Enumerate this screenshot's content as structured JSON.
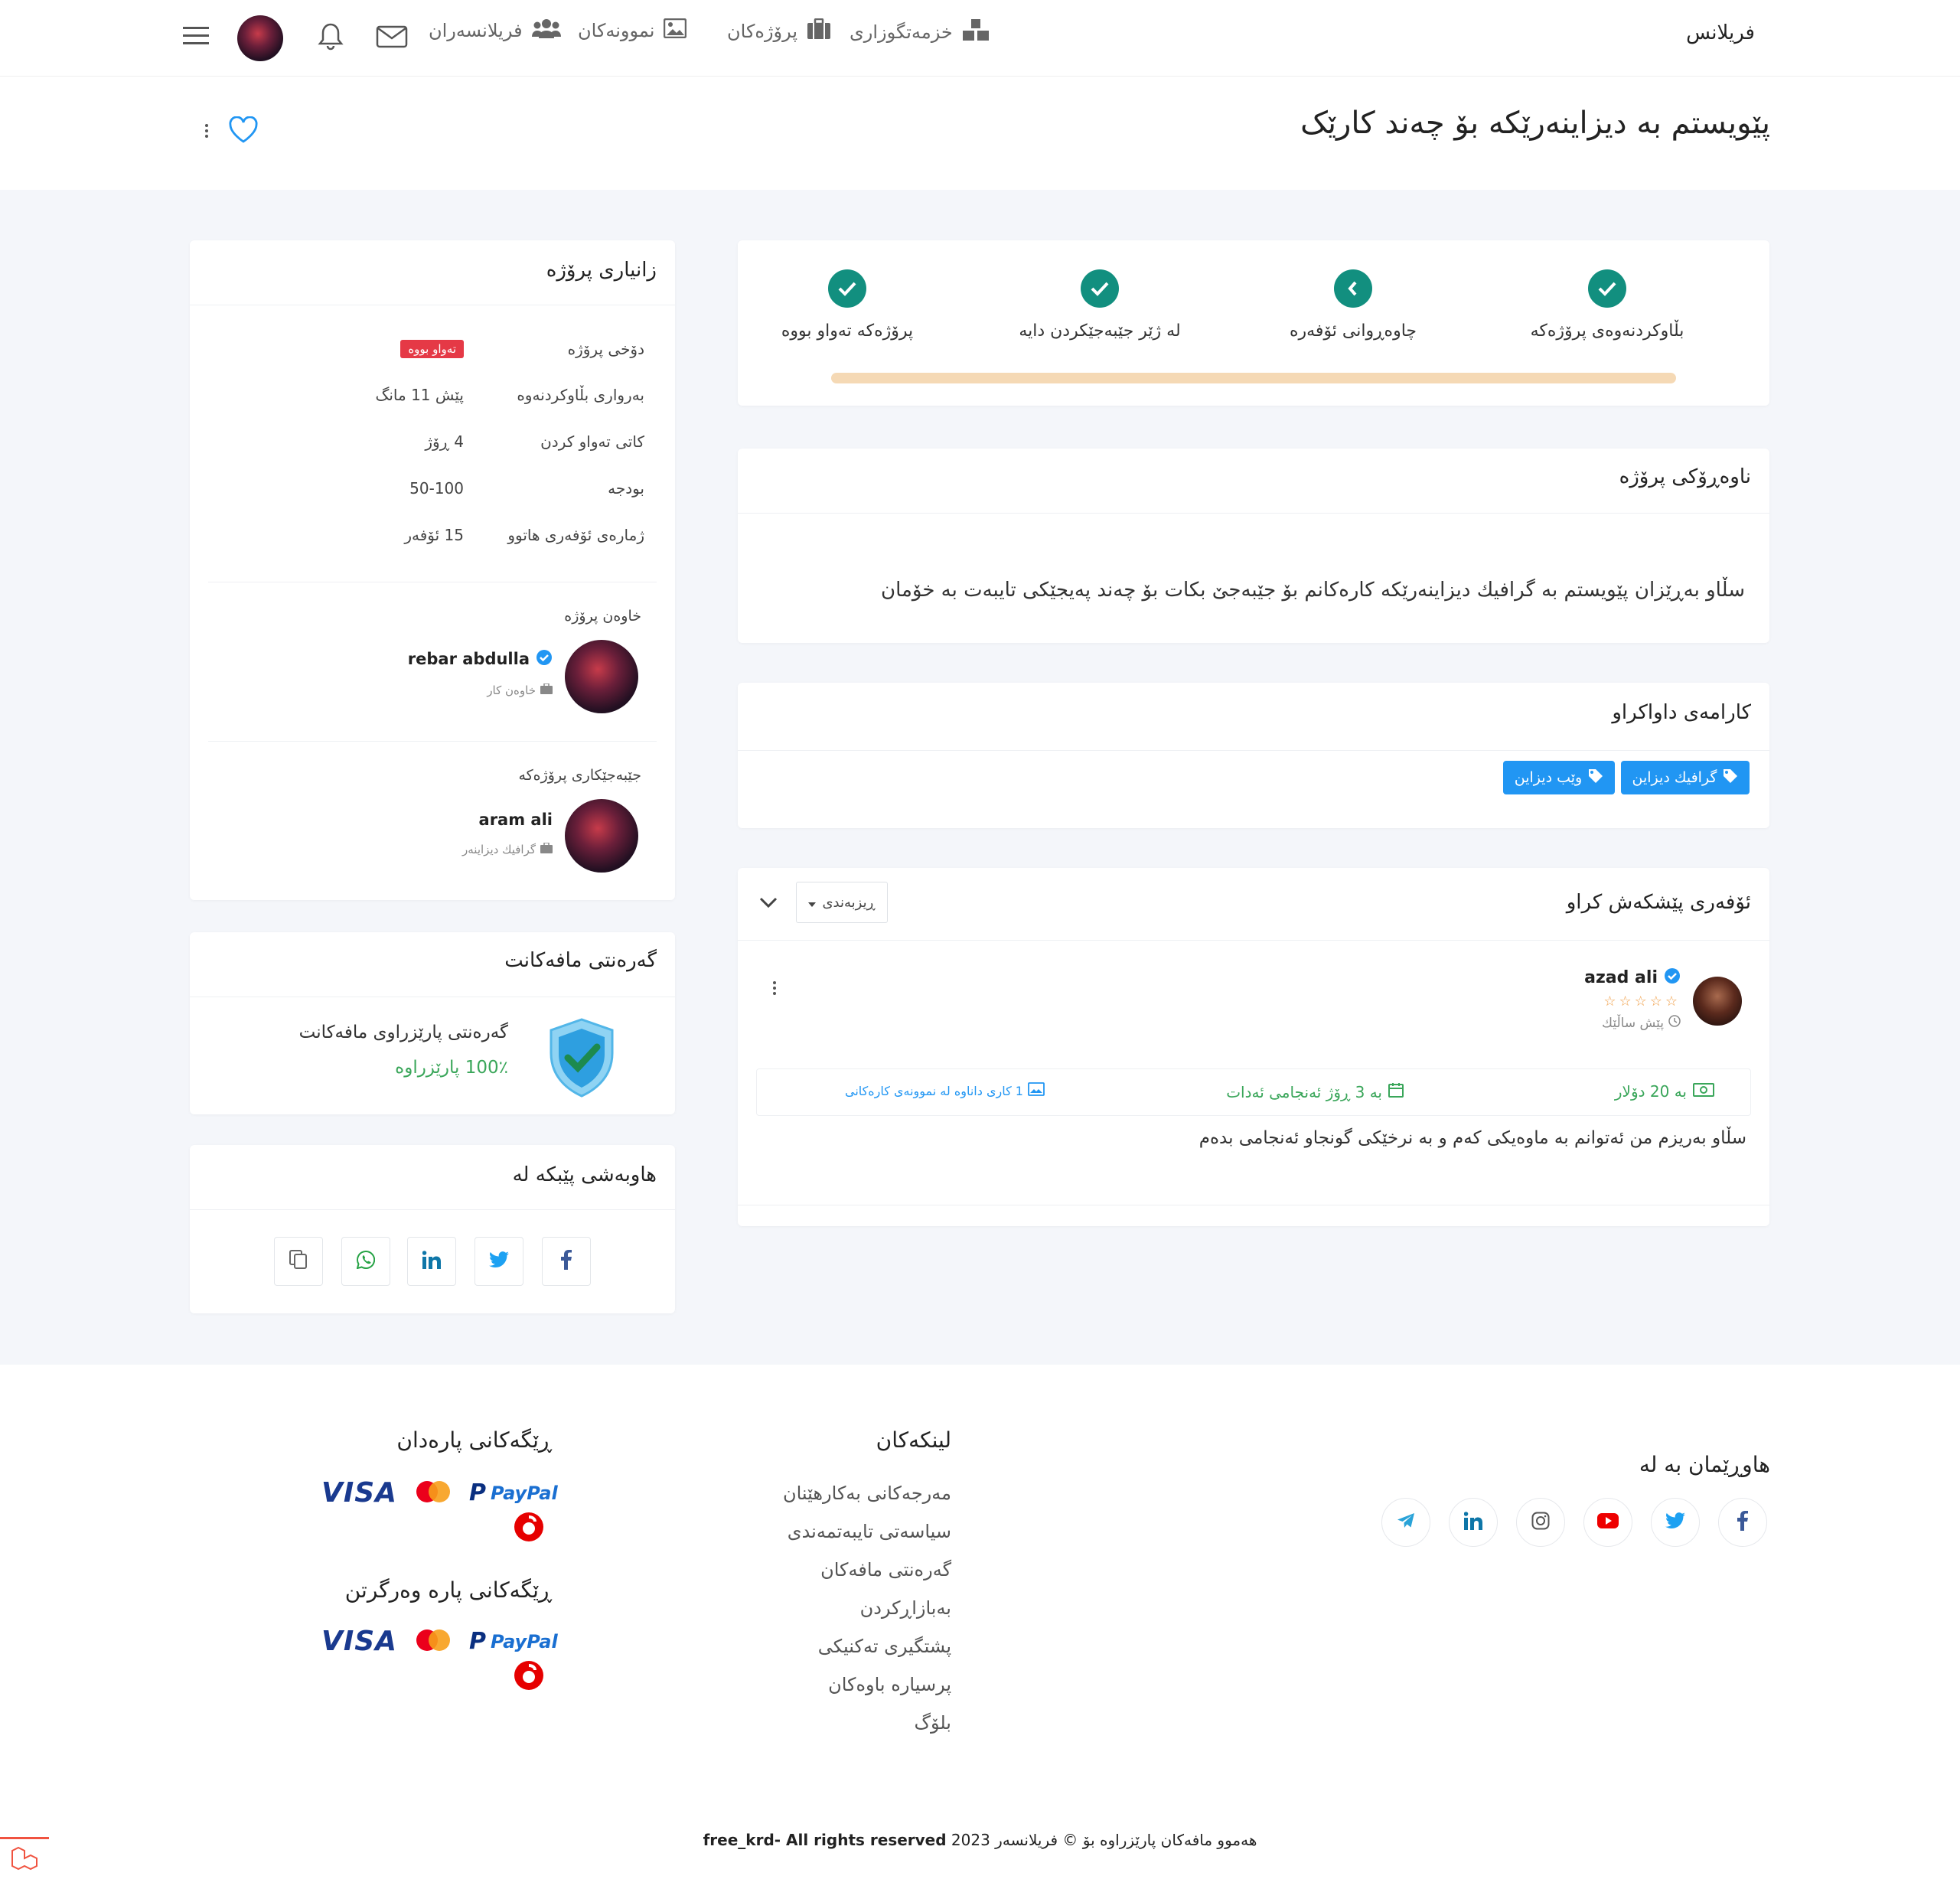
{
  "nav": {
    "brand": "فریلانس",
    "items": [
      {
        "label": "خزمەتگوزاری",
        "icon": "services-icon"
      },
      {
        "label": "پرۆژەکان",
        "icon": "briefcase-icon"
      },
      {
        "label": "نموونەکان",
        "icon": "image-icon"
      },
      {
        "label": "فریلانسەران",
        "icon": "users-icon"
      }
    ]
  },
  "page": {
    "title": "پێویستم بە دیزاینەرێکە بۆ چەند کارێک"
  },
  "steps": [
    {
      "label": "بڵاوکردنەوەی پرۆژەکە",
      "icon": "check-icon"
    },
    {
      "label": "چاوەڕوانی ئۆفەرە",
      "icon": "chevron-left-icon"
    },
    {
      "label": "لە ژێر جێبەجێکردن دایە",
      "icon": "check-icon"
    },
    {
      "label": "پرۆژەکە تەواو بووە",
      "icon": "check-icon"
    }
  ],
  "description": {
    "title": "ناوەڕۆکی پرۆژە",
    "text": "سڵاو بەڕێزان پێویستم بە گرافیك دیزاینەرێکە کارەکانم بۆ جێبەجێ بکات بۆ چەند پەیجێکی تایبەت بە خۆمان"
  },
  "skills": {
    "title": "کارامەی داواکراو",
    "tags": [
      "گرافیك دیزاین",
      "وێب دیزاین"
    ]
  },
  "offers": {
    "title": "ئۆفەری پێشکەش کراو",
    "sort_label": "ڕیزبەندی",
    "items": [
      {
        "name": "azad ali",
        "time": "پێش ساڵێك",
        "stars": 5,
        "price": "بە 20 دۆلار",
        "duration": "بە 3 ڕۆژ ئەنجامی ئەدات",
        "portfolio": "1 کاری داناوە لە نموونەی کارەکانی",
        "message": "سڵاو بەریزم من ئەتوانم بە ماوەیکی کەم و بە نرخێکی گونجاو ئەنجامی بدەم"
      }
    ]
  },
  "info": {
    "title": "زانیاری پرۆژە",
    "rows": [
      {
        "key": "دۆخی پرۆژە",
        "value": "تەواو بووە"
      },
      {
        "key": "بەرواری بڵاوکردنەوە",
        "value": "پێش 11 مانگ"
      },
      {
        "key": "کاتی تەواو کردن",
        "value": "4 ڕۆژ"
      },
      {
        "key": "بودجە",
        "value": "50-100"
      },
      {
        "key": "ژمارەی ئۆفەری هاتوو",
        "value": "15 ئۆفەر"
      }
    ],
    "owner": {
      "label": "خاوەن پرۆژە",
      "name": "rebar abdulla",
      "role": "خاوەن کار"
    },
    "freelancer": {
      "label": "جێبەجێکاری پرۆژەکە",
      "name": "aram ali",
      "role": "گرافیك دیزاینەر"
    }
  },
  "guarantee": {
    "title": "گەرەنتی مافەکانت",
    "line1": "گەرەنتی پارێزراوی مافەکانت",
    "line2": "100٪ پارێزراوە"
  },
  "share": {
    "title": "هاوبەشی پێبکە لە",
    "buttons": [
      "facebook-icon",
      "twitter-icon",
      "linkedin-icon",
      "whatsapp-icon",
      "copy-icon"
    ]
  },
  "footer": {
    "follow_title": "هاوڕێمان بە لە",
    "social": [
      "facebook-icon",
      "twitter-icon",
      "youtube-icon",
      "instagram-icon",
      "linkedin-icon",
      "telegram-icon"
    ],
    "links_title": "لینکەکان",
    "links": [
      "مەرجەکانی بەکارهێنان",
      "سیاسەتی تایبەتمەندی",
      "گەرەنتی مافەکان",
      "بەبازاڕکردن",
      "پشتگیری تەکنیکی",
      "پرسیارە باوەکان",
      "بلۆگ"
    ],
    "pay_title": "ڕێگەکانی پارەدان",
    "receive_title": "ڕێگەکانی پارە وەرگرتن",
    "copyright": "هەموو مافەکان پارێزراوە بۆ © فریلانسەر 2023",
    "copyright_en": "free_krd- All rights reserved",
    "visa": "VISA",
    "paypal": "PayPal",
    "mastercard": "MasterCard"
  },
  "colors": {
    "primary": "#2196f3",
    "success": "#128f7f",
    "danger": "#e53946",
    "progress": "#f5d9b5"
  }
}
